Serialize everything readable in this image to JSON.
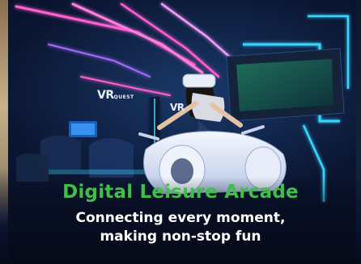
{
  "banner": {
    "title": "Digital Leisure Arcade",
    "subtitle_line1": "Connecting every moment,",
    "subtitle_line2": "making non-stop fun",
    "sign_main": "VR",
    "sign_small": "QUEST",
    "sign_secondary": "VR"
  },
  "colors": {
    "title": "#3fbf4a",
    "subtitle": "#ffffff",
    "neon_pink": "#ff5fd0",
    "neon_cyan": "#38d6ff",
    "neon_violet": "#a66bff"
  }
}
